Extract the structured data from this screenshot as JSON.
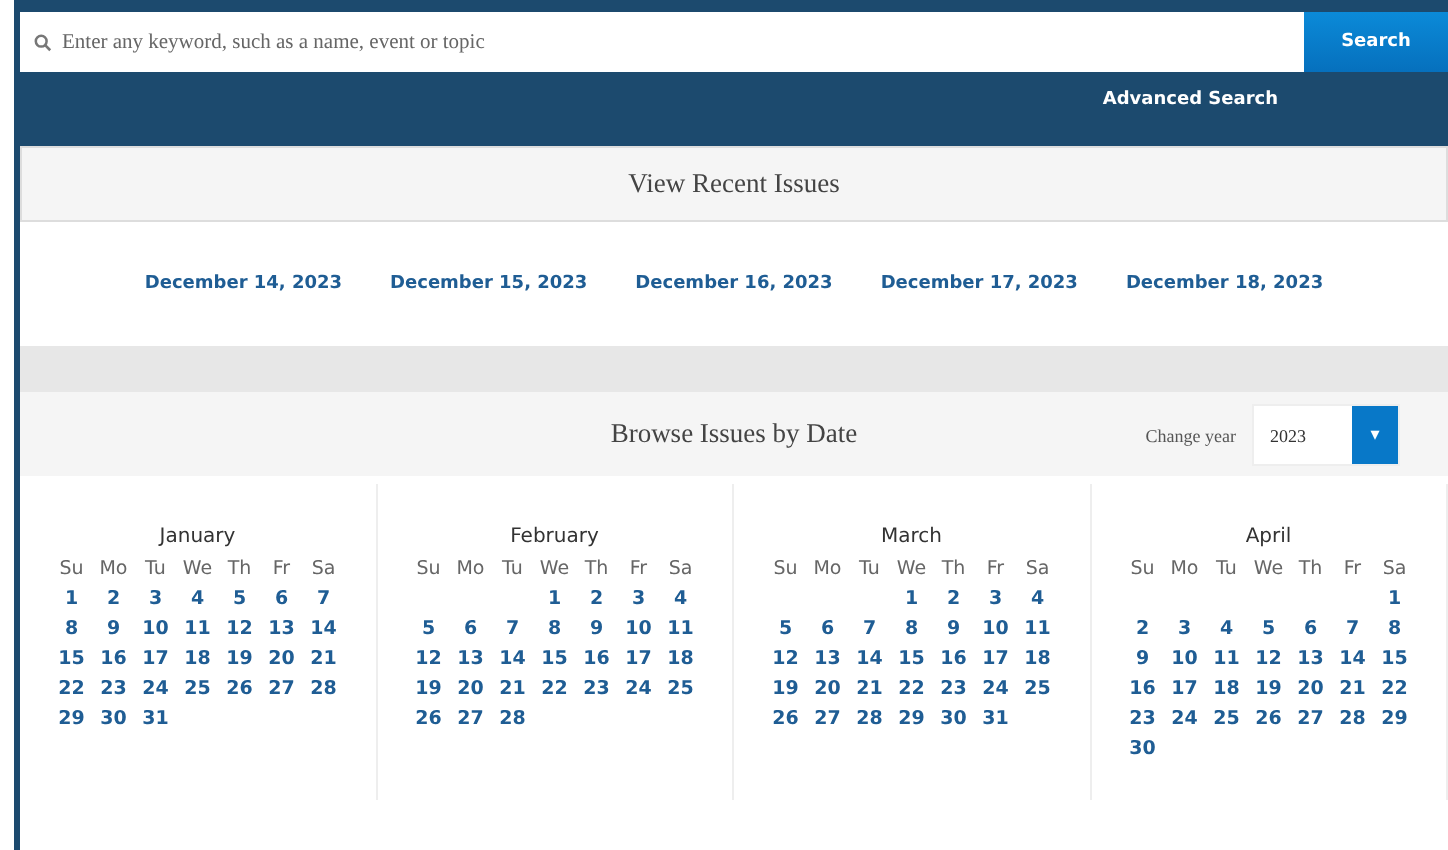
{
  "search": {
    "placeholder": "Enter any keyword, such as a name, event or topic",
    "button": "Search"
  },
  "advanced_search": "Advanced Search",
  "recent": {
    "title": "View Recent Issues",
    "dates": [
      "December 14, 2023",
      "December 15, 2023",
      "December 16, 2023",
      "December 17, 2023",
      "December 18, 2023"
    ]
  },
  "browse": {
    "title": "Browse Issues by Date",
    "year_label": "Change year",
    "year": "2023",
    "dropdown": "▾"
  },
  "months": [
    {
      "name": "January",
      "weekdays": [
        "Su",
        "Mo",
        "Tu",
        "We",
        "Th",
        "Fr",
        "Sa"
      ],
      "weeks": [
        [
          "1",
          "2",
          "3",
          "4",
          "5",
          "6",
          "7"
        ],
        [
          "8",
          "9",
          "10",
          "11",
          "12",
          "13",
          "14"
        ],
        [
          "15",
          "16",
          "17",
          "18",
          "19",
          "20",
          "21"
        ],
        [
          "22",
          "23",
          "24",
          "25",
          "26",
          "27",
          "28"
        ],
        [
          "29",
          "30",
          "31"
        ]
      ]
    },
    {
      "name": "February",
      "weekdays": [
        "Su",
        "Mo",
        "Tu",
        "We",
        "Th",
        "Fr",
        "Sa"
      ],
      "weeks": [
        [
          "1",
          "2",
          "3",
          "4"
        ],
        [
          "5",
          "6",
          "7",
          "8",
          "9",
          "10",
          "11"
        ],
        [
          "12",
          "13",
          "14",
          "15",
          "16",
          "17",
          "18"
        ],
        [
          "19",
          "20",
          "21",
          "22",
          "23",
          "24",
          "25"
        ],
        [
          "26",
          "27",
          "28"
        ]
      ]
    },
    {
      "name": "March",
      "weekdays": [
        "Su",
        "Mo",
        "Tu",
        "We",
        "Th",
        "Fr",
        "Sa"
      ],
      "weeks": [
        [
          "1",
          "2",
          "3",
          "4"
        ],
        [
          "5",
          "6",
          "7",
          "8",
          "9",
          "10",
          "11"
        ],
        [
          "12",
          "13",
          "14",
          "15",
          "16",
          "17",
          "18"
        ],
        [
          "19",
          "20",
          "21",
          "22",
          "23",
          "24",
          "25"
        ],
        [
          "26",
          "27",
          "28",
          "29",
          "30",
          "31"
        ]
      ]
    },
    {
      "name": "April",
      "weekdays": [
        "Su",
        "Mo",
        "Tu",
        "We",
        "Th",
        "Fr",
        "Sa"
      ],
      "weeks": [
        [
          "1"
        ],
        [
          "2",
          "3",
          "4",
          "5",
          "6",
          "7",
          "8"
        ],
        [
          "9",
          "10",
          "11",
          "12",
          "13",
          "14",
          "15"
        ],
        [
          "16",
          "17",
          "18",
          "19",
          "20",
          "21",
          "22"
        ],
        [
          "23",
          "24",
          "25",
          "26",
          "27",
          "28",
          "29"
        ],
        [
          "30"
        ]
      ]
    }
  ]
}
